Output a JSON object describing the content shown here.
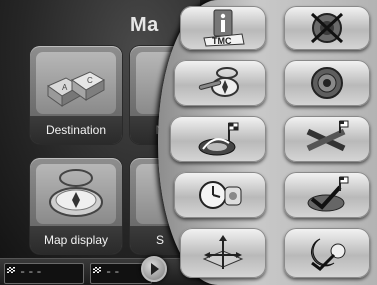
{
  "main_menu": {
    "title": "Ma",
    "tiles": {
      "destination": {
        "label": "Destination"
      },
      "map_display": {
        "label": "Map display"
      },
      "clip_top_label": "N",
      "clip_bottom_label": "S"
    }
  },
  "bottom_bar": {
    "field1": "---",
    "field2": "--"
  },
  "settings_panel": {
    "buttons": [
      {
        "icon": "info-tmc-icon",
        "text": "TMC"
      },
      {
        "icon": "volume-mute-icon"
      },
      {
        "icon": "compass-wrench-icon"
      },
      {
        "icon": "speaker-volume-icon"
      },
      {
        "icon": "route-flag-target-icon"
      },
      {
        "icon": "crossed-roads-flag-icon"
      },
      {
        "icon": "clock-tape-icon"
      },
      {
        "icon": "route-check-flag-icon"
      },
      {
        "icon": "map-arrows-icon"
      },
      {
        "icon": "day-night-icon"
      }
    ]
  }
}
